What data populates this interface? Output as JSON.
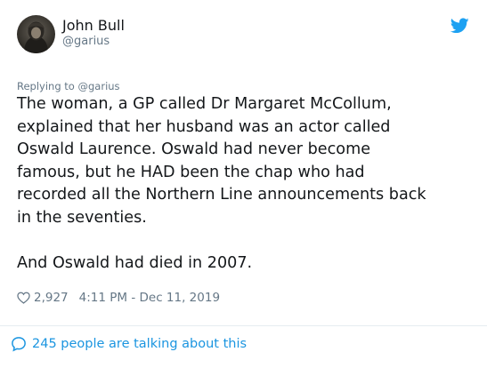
{
  "user": {
    "display_name": "John Bull",
    "handle": "@garius"
  },
  "icons": {
    "brand": "twitter-bird-icon",
    "like": "heart-icon",
    "conversation": "speech-bubble-icon"
  },
  "colors": {
    "twitter_blue": "#1da1f2",
    "link_blue": "#1b95e0",
    "secondary_text": "#657786",
    "primary_text": "#14171a"
  },
  "tweet": {
    "replying_prefix": "Replying to ",
    "replying_to": "@garius",
    "paragraph_1": "The woman, a GP called Dr Margaret McCollum,\nexplained that her husband was an actor called\nOswald Laurence. Oswald had never become\nfamous, but he HAD been the chap who had\nrecorded all the Northern Line announcements back\nin the seventies.",
    "paragraph_2": "And Oswald had died in 2007.",
    "likes": "2,927",
    "timestamp": "4:11 PM - Dec 11, 2019"
  },
  "footer": {
    "talking_label": "245 people are talking about this"
  }
}
